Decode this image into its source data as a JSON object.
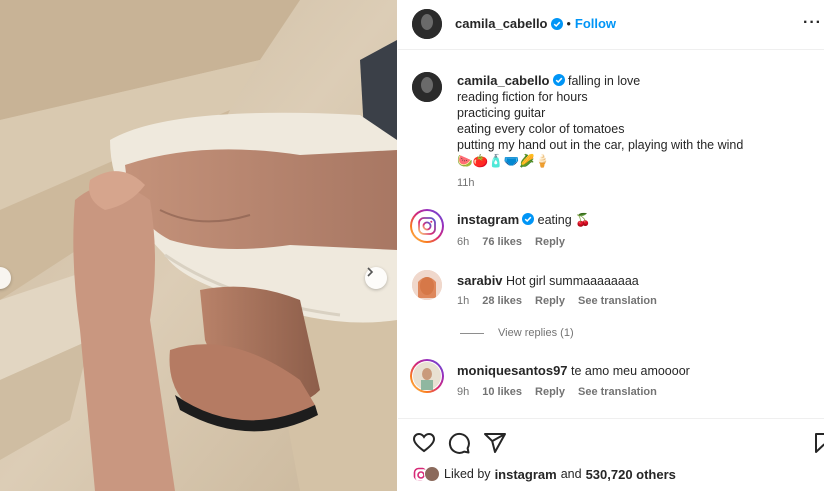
{
  "post": {
    "author": "camila_cabello",
    "follow_label": "Follow",
    "separator": "•",
    "more_label": "···"
  },
  "caption": {
    "author": "camila_cabello",
    "lines": [
      "falling in love",
      "reading fiction for hours",
      "practicing guitar",
      "eating every color of tomatoes",
      "putting my hand out in the car, playing with the wind"
    ],
    "emoji_line": "🍉🍅🧴🩲🌽🍦",
    "time": "11h"
  },
  "comments": [
    {
      "user": "instagram",
      "verified": true,
      "text": "eating 🍒",
      "time": "6h",
      "likes": "76 likes",
      "reply": "Reply",
      "translate": ""
    },
    {
      "user": "sarabiv",
      "verified": false,
      "text": "Hot girl summaaaaaaaa",
      "time": "1h",
      "likes": "28 likes",
      "reply": "Reply",
      "translate": "See translation"
    },
    {
      "user": "moniquesantos97",
      "verified": false,
      "text": "te amo meu amoooor",
      "time": "9h",
      "likes": "10 likes",
      "reply": "Reply",
      "translate": "See translation"
    }
  ],
  "view_replies": "View replies (1)",
  "likes": {
    "prefix": "Liked by",
    "user": "instagram",
    "conj": "and",
    "count": "530,720 others"
  },
  "icons": [
    "heart-icon",
    "comment-icon",
    "share-icon",
    "bookmark-icon",
    "verified-icon",
    "chevron-right-icon",
    "more-icon"
  ],
  "colors": {
    "accent": "#0095f6",
    "verified": "#0095f6",
    "muted": "#737373"
  }
}
